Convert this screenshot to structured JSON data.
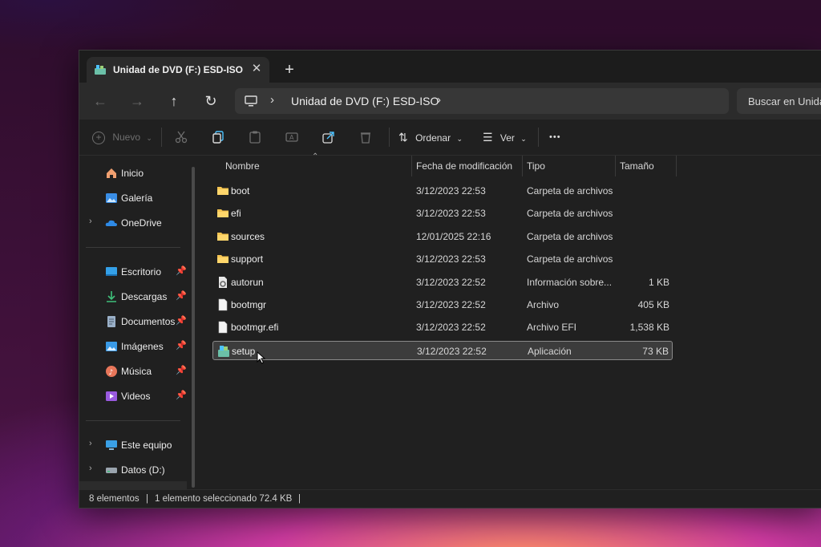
{
  "tab": {
    "title": "Unidad de DVD (F:) ESD-ISO",
    "close": "✕",
    "new_tab": "+"
  },
  "nav": {
    "back": "←",
    "forward": "→",
    "up": "↑",
    "refresh": "↻",
    "address_separator": "›",
    "address_path": "Unidad de DVD (F:) ESD-ISO",
    "search_placeholder": "Buscar en Unida"
  },
  "toolbar": {
    "new_label": "Nuevo",
    "sort_label": "Ordenar",
    "view_label": "Ver",
    "more_label": "•••"
  },
  "sidebar": {
    "items": [
      {
        "label": "Inicio",
        "icon": "home-icon"
      },
      {
        "label": "Galería",
        "icon": "gallery-icon"
      },
      {
        "label": "OneDrive",
        "icon": "cloud-icon"
      },
      {
        "label": "Escritorio",
        "icon": "desktop-icon"
      },
      {
        "label": "Descargas",
        "icon": "download-icon"
      },
      {
        "label": "Documentos",
        "icon": "document-icon"
      },
      {
        "label": "Imágenes",
        "icon": "pictures-icon"
      },
      {
        "label": "Música",
        "icon": "music-icon"
      },
      {
        "label": "Videos",
        "icon": "video-icon"
      },
      {
        "label": "Este equipo",
        "icon": "computer-icon"
      },
      {
        "label": "Datos (D:)",
        "icon": "drive-icon"
      }
    ]
  },
  "columns": {
    "name": "Nombre",
    "date": "Fecha de modificación",
    "type": "Tipo",
    "size": "Tamaño"
  },
  "files": [
    {
      "name": "boot",
      "date": "3/12/2023 22:53",
      "type": "Carpeta de archivos",
      "size": "",
      "icon": "folder-icon"
    },
    {
      "name": "efi",
      "date": "3/12/2023 22:53",
      "type": "Carpeta de archivos",
      "size": "",
      "icon": "folder-icon"
    },
    {
      "name": "sources",
      "date": "12/01/2025 22:16",
      "type": "Carpeta de archivos",
      "size": "",
      "icon": "folder-icon"
    },
    {
      "name": "support",
      "date": "3/12/2023 22:53",
      "type": "Carpeta de archivos",
      "size": "",
      "icon": "folder-icon"
    },
    {
      "name": "autorun",
      "date": "3/12/2023 22:52",
      "type": "Información sobre...",
      "size": "1 KB",
      "icon": "settings-file-icon"
    },
    {
      "name": "bootmgr",
      "date": "3/12/2023 22:52",
      "type": "Archivo",
      "size": "405 KB",
      "icon": "file-icon"
    },
    {
      "name": "bootmgr.efi",
      "date": "3/12/2023 22:52",
      "type": "Archivo EFI",
      "size": "1,538 KB",
      "icon": "file-icon"
    },
    {
      "name": "setup",
      "date": "3/12/2023 22:52",
      "type": "Aplicación",
      "size": "73 KB",
      "icon": "setup-app-icon",
      "selected": true
    }
  ],
  "status": {
    "count": "8 elementos",
    "selection": "1 elemento seleccionado  72.4 KB",
    "divider": "|"
  },
  "colors": {
    "folder": "#f5c451",
    "accent": "#4cc2ff",
    "selection_border": "#8a8a8a"
  }
}
